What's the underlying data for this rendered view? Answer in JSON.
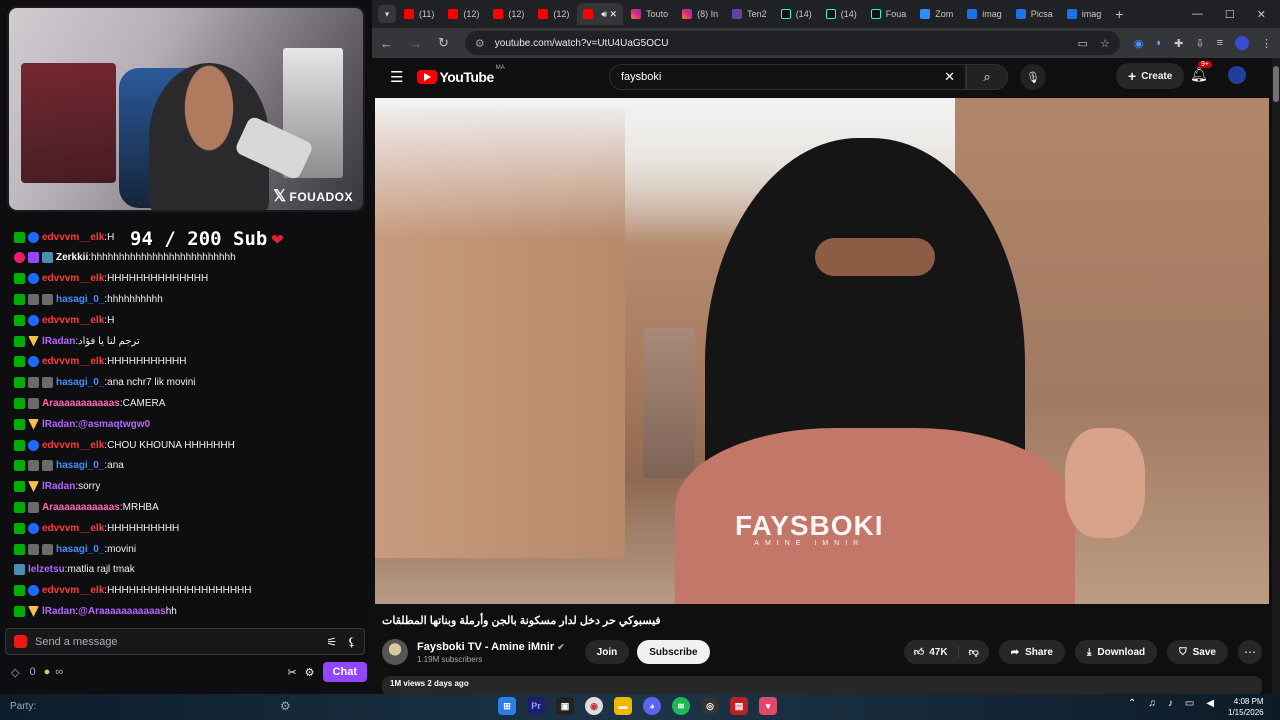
{
  "stream": {
    "handle": "FOUADOX",
    "sub_goal": {
      "current": "94",
      "separator": "/",
      "target": "200",
      "label": "Sub"
    },
    "chat_messages": [
      {
        "user": "edvvvm__elk",
        "color": "red",
        "badges": [
          "mod",
          "blue"
        ],
        "text": "H"
      },
      {
        "user": "Zerkkii",
        "color": "white",
        "badges": [
          "pink",
          "purple",
          "teal"
        ],
        "text": "hhhhhhhhhhhhhhhhhhhhhhhhhh"
      },
      {
        "user": "edvvvm__elk",
        "color": "red",
        "badges": [
          "mod",
          "blue"
        ],
        "text": "HHHHHHHHHHHHHH"
      },
      {
        "user": "hasagi_0_",
        "color": "blue",
        "badges": [
          "mod",
          "gray",
          "gray"
        ],
        "text": "hhhhhhhhhh"
      },
      {
        "user": "edvvvm__elk",
        "color": "red",
        "badges": [
          "mod",
          "blue"
        ],
        "text": "H"
      },
      {
        "user": "lRadan",
        "color": "violet",
        "badges": [
          "mod",
          "gold"
        ],
        "text": "ترجم لنا يا فؤاد"
      },
      {
        "user": "edvvvm__elk",
        "color": "red",
        "badges": [
          "mod",
          "blue"
        ],
        "text": "HHHHHHHHHHH"
      },
      {
        "user": "hasagi_0_",
        "color": "blue",
        "badges": [
          "mod",
          "gray",
          "gray"
        ],
        "text": "ana nchr7 lik movini"
      },
      {
        "user": "Araaaaaaaaaaas",
        "color": "pink",
        "badges": [
          "mod",
          "gray"
        ],
        "text": "CAMERA"
      },
      {
        "user": "lRadan",
        "color": "violet",
        "badges": [
          "mod",
          "gold"
        ],
        "text": "",
        "mention": "@asmaqtwgw0"
      },
      {
        "user": "edvvvm__elk",
        "color": "red",
        "badges": [
          "mod",
          "blue"
        ],
        "text": "CHOU KHOUNA HHHHHHH"
      },
      {
        "user": "hasagi_0_",
        "color": "blue",
        "badges": [
          "mod",
          "gray",
          "gray"
        ],
        "text": "ana"
      },
      {
        "user": "lRadan",
        "color": "violet",
        "badges": [
          "mod",
          "gold"
        ],
        "text": "sorry"
      },
      {
        "user": "Araaaaaaaaaaas",
        "color": "pink",
        "badges": [
          "mod",
          "gray"
        ],
        "text": "MRHBA"
      },
      {
        "user": "edvvvm__elk",
        "color": "red",
        "badges": [
          "mod",
          "blue"
        ],
        "text": "HHHHHHHHHH"
      },
      {
        "user": "hasagi_0_",
        "color": "blue",
        "badges": [
          "mod",
          "gray",
          "gray"
        ],
        "text": "movini"
      },
      {
        "user": "lelzetsu",
        "color": "violet",
        "badges": [
          "teal"
        ],
        "text": "matlia rajl tmak"
      },
      {
        "user": "edvvvm__elk",
        "color": "red",
        "badges": [
          "mod",
          "blue"
        ],
        "text": "HHHHHHHHHHHHHHHHHHHH"
      },
      {
        "user": "lRadan",
        "color": "violet",
        "badges": [
          "mod",
          "gold"
        ],
        "text": "hh",
        "mention": "@Araaaaaaaaaaas"
      }
    ],
    "message_placeholder": "Send a message",
    "points": "0",
    "infinity": "∞",
    "chat_button": "Chat"
  },
  "browser": {
    "tabs": [
      {
        "label": "(11)",
        "icon": "yt"
      },
      {
        "label": "(12)",
        "icon": "yt"
      },
      {
        "label": "(12)",
        "icon": "yt"
      },
      {
        "label": "(12)",
        "icon": "yt"
      },
      {
        "label": "",
        "icon": "yt",
        "active": true
      },
      {
        "label": "Touto",
        "icon": "ig"
      },
      {
        "label": "(8) In",
        "icon": "ig"
      },
      {
        "label": "Ten2",
        "icon": "tw"
      },
      {
        "label": "(14)",
        "icon": "tt"
      },
      {
        "label": "(14)",
        "icon": "tt"
      },
      {
        "label": "Foua",
        "icon": "tt"
      },
      {
        "label": "Zom",
        "icon": "zm"
      },
      {
        "label": "imag",
        "icon": "img"
      },
      {
        "label": "Picsa",
        "icon": "img"
      },
      {
        "label": "imag",
        "icon": "img"
      }
    ],
    "url": "youtube.com/watch?v=UtU4UaG5OCU"
  },
  "youtube": {
    "logo_word": "YouTube",
    "country": "MA",
    "search_value": "faysboki",
    "create_label": "Create",
    "notif_count": "9+",
    "watermark_big": "FAYSBOKI",
    "watermark_small": "AMINE IMNIR",
    "video_title": "فيسبوكي حر دخل لدار مسكونة بالجن وأرملة وبناتها المطلقات",
    "channel_name": "Faysboki TV - Amine iMnir",
    "subscribers": "1.19M subscribers",
    "join_label": "Join",
    "subscribe_label": "Subscribe",
    "likes": "47K",
    "share_label": "Share",
    "download_label": "Download",
    "save_label": "Save",
    "desc_preview": "1M views  2 days ago"
  },
  "taskbar": {
    "party_label": "Party:",
    "time": "4:08 PM",
    "date": "1/15/2026"
  }
}
